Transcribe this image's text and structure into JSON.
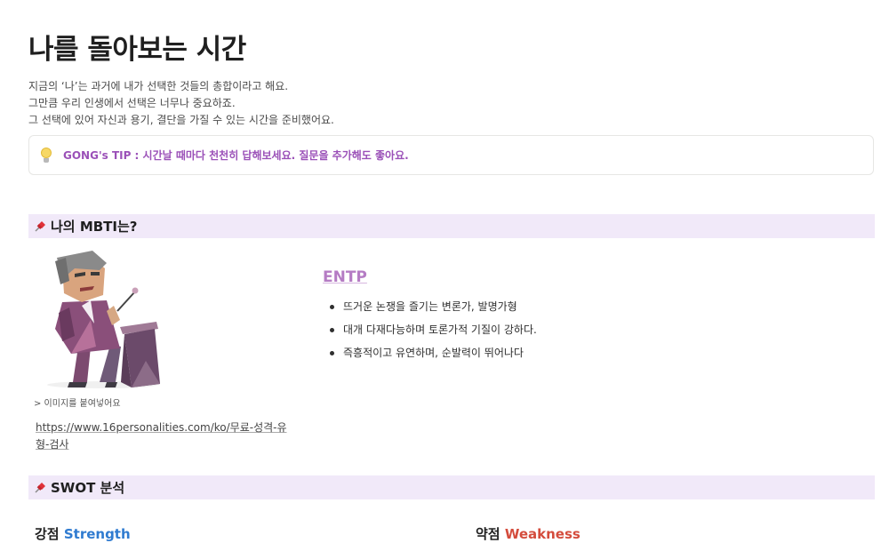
{
  "page": {
    "title": "나를 돌아보는 시간",
    "intro": [
      "지금의 ‘나’는 과거에 내가 선택한 것들의 총합이라고 해요.",
      "그만큼 우리 인생에서 선택은 너무나 중요하죠.",
      "그 선택에 있어 자신과 용기, 결단을 가질 수 있는 시간을 준비했어요."
    ]
  },
  "callout": {
    "icon": "lightbulb-icon",
    "text": "GONG's TIP : 시간날 때마다 천천히 답해보세요. 질문을 추가해도 좋아요."
  },
  "mbti_section": {
    "title": "나의 MBTI는?",
    "icon": "pushpin-icon",
    "image_caption": "> 이미지를 붙여넣어요",
    "link": "https://www.16personalities.com/ko/무료-성격-유형-검사",
    "type": "ENTP",
    "traits": [
      "뜨거운 논쟁을 즐기는 변론가, 발명가형",
      "대개 다재다능하며 토론가적 기질이 강하다.",
      "즉흥적이고 유연하며, 순발력이 뛰어나다"
    ]
  },
  "swot_section": {
    "title": "SWOT 분석",
    "icon": "pushpin-icon",
    "strength_ko": "강점",
    "strength_en": "Strength",
    "weakness_ko": "약점",
    "weakness_en": "Weakness"
  },
  "colors": {
    "section_bg": "#f1e9f9",
    "accent_purple": "#9b51b8",
    "mbti_type": "#b57cc4",
    "strength_blue": "#2f7bd0",
    "weakness_red": "#d44c3c"
  }
}
